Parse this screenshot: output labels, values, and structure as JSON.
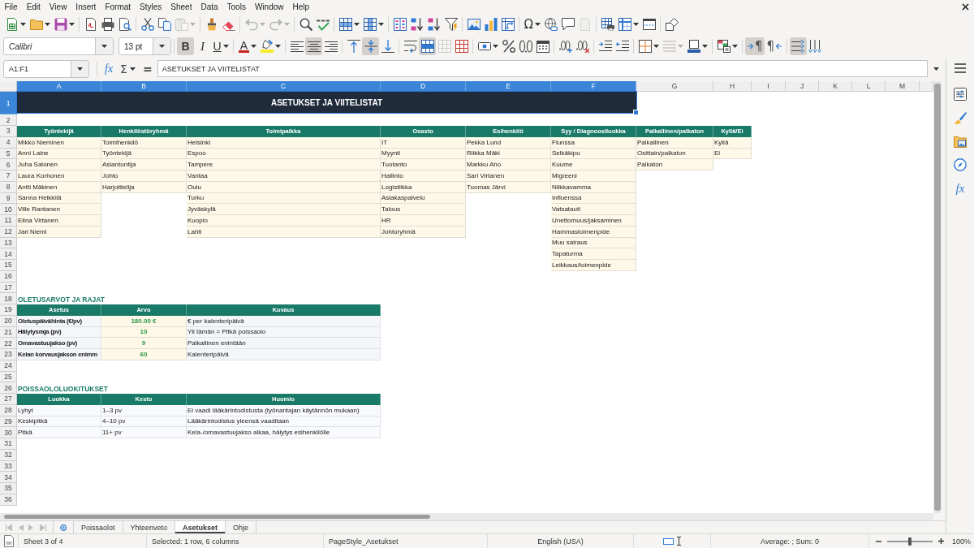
{
  "menu_bar": {
    "items": [
      "File",
      "Edit",
      "View",
      "Insert",
      "Format",
      "Styles",
      "Sheet",
      "Data",
      "Tools",
      "Window",
      "Help"
    ]
  },
  "standard_toolbar": {
    "groups": [
      [
        {
          "kind": "new",
          "menu": true,
          "disabled": false
        },
        {
          "kind": "open",
          "menu": true,
          "disabled": false
        },
        {
          "kind": "save",
          "menu": true,
          "disabled": false
        }
      ],
      [
        {
          "kind": "export_pdf",
          "menu": false,
          "disabled": false
        },
        {
          "kind": "print",
          "menu": false,
          "disabled": false
        },
        {
          "kind": "print_preview",
          "menu": false,
          "disabled": false
        }
      ],
      [
        {
          "kind": "cut",
          "menu": false,
          "disabled": false
        },
        {
          "kind": "copy",
          "menu": false,
          "disabled": false
        },
        {
          "kind": "paste",
          "menu": true,
          "disabled": true
        }
      ],
      [
        {
          "kind": "clone_format",
          "menu": false,
          "disabled": false
        },
        {
          "kind": "clear_format",
          "menu": false,
          "disabled": false
        }
      ],
      [
        {
          "kind": "undo",
          "menu": true,
          "disabled": true
        },
        {
          "kind": "redo",
          "menu": true,
          "disabled": true
        }
      ],
      [
        {
          "kind": "find_replace",
          "menu": false,
          "disabled": false
        },
        {
          "kind": "spelling",
          "menu": false,
          "disabled": false
        }
      ],
      [
        {
          "kind": "row",
          "menu": true,
          "disabled": false
        },
        {
          "kind": "column",
          "menu": true,
          "disabled": false
        }
      ],
      [
        {
          "kind": "sort",
          "menu": false,
          "disabled": false
        },
        {
          "kind": "sort_ascending",
          "menu": false,
          "disabled": false
        },
        {
          "kind": "sort_descending",
          "menu": false,
          "disabled": false
        },
        {
          "kind": "autofilter",
          "menu": false,
          "disabled": false
        }
      ],
      [
        {
          "kind": "image",
          "menu": false,
          "disabled": false
        },
        {
          "kind": "chart",
          "menu": false,
          "disabled": false
        },
        {
          "kind": "pivot_table",
          "menu": false,
          "disabled": false
        }
      ],
      [
        {
          "kind": "special_character",
          "glyph": "Ω",
          "menu": true,
          "disabled": false
        },
        {
          "kind": "hyperlink",
          "menu": false,
          "disabled": false
        },
        {
          "kind": "comment",
          "menu": false,
          "disabled": false
        },
        {
          "kind": "header_footer",
          "menu": false,
          "disabled": true
        }
      ],
      [
        {
          "kind": "print_area",
          "menu": false,
          "disabled": false
        },
        {
          "kind": "freeze",
          "menu": true,
          "disabled": false
        },
        {
          "kind": "split_window",
          "menu": false,
          "disabled": false
        }
      ],
      [
        {
          "kind": "draw_functions",
          "menu": false,
          "disabled": false
        }
      ]
    ]
  },
  "format_toolbar": {
    "font_name": "Calibri",
    "font_size": "13 pt",
    "groups": [
      [
        {
          "kind": "bold",
          "glyph": "B",
          "menu": false,
          "on": true,
          "disabled": false
        },
        {
          "kind": "italic",
          "glyph": "I",
          "menu": false,
          "on": false,
          "disabled": false
        },
        {
          "kind": "underline",
          "glyph": "U",
          "menu": true,
          "on": false,
          "disabled": false
        }
      ],
      [
        {
          "kind": "font_color",
          "glyph": "A",
          "menu": true,
          "on": false,
          "disabled": false
        },
        {
          "kind": "highlight",
          "menu": true,
          "on": false,
          "disabled": false
        }
      ],
      [
        {
          "kind": "align_left",
          "menu": false,
          "on": false,
          "disabled": false
        },
        {
          "kind": "align_center",
          "menu": false,
          "on": true,
          "disabled": false
        },
        {
          "kind": "align_right",
          "menu": false,
          "on": false,
          "disabled": false
        }
      ],
      [
        {
          "kind": "align_top",
          "menu": false,
          "on": false,
          "disabled": false
        },
        {
          "kind": "align_middle",
          "menu": false,
          "on": true,
          "disabled": false
        },
        {
          "kind": "align_bottom",
          "menu": false,
          "on": false,
          "disabled": false
        }
      ],
      [
        {
          "kind": "wrap_text",
          "menu": false,
          "on": false,
          "disabled": false
        },
        {
          "kind": "merge_center",
          "menu": false,
          "on": true,
          "disabled": false
        },
        {
          "kind": "merge_cells",
          "menu": false,
          "on": false,
          "disabled": true
        },
        {
          "kind": "unmerge",
          "menu": false,
          "on": false,
          "disabled": false
        }
      ],
      [
        {
          "kind": "currency",
          "menu": true,
          "on": false,
          "disabled": false
        },
        {
          "kind": "percent",
          "menu": false,
          "on": false,
          "disabled": false
        },
        {
          "kind": "number",
          "menu": false,
          "on": false,
          "disabled": false
        },
        {
          "kind": "date",
          "menu": false,
          "on": false,
          "disabled": false
        }
      ],
      [
        {
          "kind": "add_decimal",
          "menu": false,
          "on": false,
          "disabled": false
        },
        {
          "kind": "delete_decimal",
          "menu": false,
          "on": false,
          "disabled": false
        }
      ],
      [
        {
          "kind": "increase_indent",
          "menu": false,
          "on": false,
          "disabled": false
        },
        {
          "kind": "decrease_indent",
          "menu": false,
          "on": false,
          "disabled": false
        }
      ],
      [
        {
          "kind": "borders",
          "menu": true,
          "on": false,
          "disabled": false
        },
        {
          "kind": "border_style",
          "menu": true,
          "on": false,
          "disabled": true
        },
        {
          "kind": "border_color",
          "menu": true,
          "on": false,
          "disabled": false
        }
      ],
      [
        {
          "kind": "conditional",
          "menu": true,
          "on": false,
          "disabled": false
        }
      ],
      [
        {
          "kind": "ltr",
          "glyph": "¶",
          "menu": false,
          "on": true,
          "disabled": false
        },
        {
          "kind": "rtl",
          "glyph": "¶",
          "menu": false,
          "on": false,
          "disabled": false
        }
      ],
      [
        {
          "kind": "text_ltr",
          "menu": false,
          "on": true,
          "disabled": false
        },
        {
          "kind": "text_ttb",
          "menu": false,
          "on": false,
          "disabled": false
        }
      ]
    ]
  },
  "formula_bar": {
    "name_box": "A1:F1",
    "function_wizard": "fx",
    "sum": "Σ",
    "formula": "=",
    "content": "ASETUKSET JA VIITELISTAT"
  },
  "sheet": {
    "columns": [
      {
        "label": "A",
        "selected": true
      },
      {
        "label": "B",
        "selected": true
      },
      {
        "label": "C",
        "selected": true
      },
      {
        "label": "D",
        "selected": true
      },
      {
        "label": "E",
        "selected": true
      },
      {
        "label": "F",
        "selected": true
      },
      {
        "label": "G",
        "selected": false
      },
      {
        "label": "H",
        "selected": false
      },
      {
        "label": "I",
        "selected": false
      },
      {
        "label": "J",
        "selected": false
      },
      {
        "label": "K",
        "selected": false
      },
      {
        "label": "L",
        "selected": false
      },
      {
        "label": "M",
        "selected": false
      }
    ],
    "rows": [
      {
        "label": "1",
        "selected": true
      },
      {
        "label": "2",
        "selected": false
      },
      {
        "label": "3",
        "selected": false
      },
      {
        "label": "4",
        "selected": false
      },
      {
        "label": "5",
        "selected": false
      },
      {
        "label": "6",
        "selected": false
      },
      {
        "label": "7",
        "selected": false
      },
      {
        "label": "8",
        "selected": false
      },
      {
        "label": "9",
        "selected": false
      },
      {
        "label": "10",
        "selected": false
      },
      {
        "label": "11",
        "selected": false
      },
      {
        "label": "12",
        "selected": false
      },
      {
        "label": "13",
        "selected": false
      },
      {
        "label": "14",
        "selected": false
      },
      {
        "label": "15",
        "selected": false
      },
      {
        "label": "16",
        "selected": false
      },
      {
        "label": "17",
        "selected": false
      },
      {
        "label": "18",
        "selected": false
      },
      {
        "label": "19",
        "selected": false
      },
      {
        "label": "20",
        "selected": false
      },
      {
        "label": "21",
        "selected": false
      },
      {
        "label": "22",
        "selected": false
      },
      {
        "label": "23",
        "selected": false
      },
      {
        "label": "24",
        "selected": false
      },
      {
        "label": "25",
        "selected": false
      },
      {
        "label": "26",
        "selected": false
      },
      {
        "label": "27",
        "selected": false
      },
      {
        "label": "28",
        "selected": false
      },
      {
        "label": "29",
        "selected": false
      },
      {
        "label": "30",
        "selected": false
      },
      {
        "label": "31",
        "selected": false
      },
      {
        "label": "32",
        "selected": false
      },
      {
        "label": "33",
        "selected": false
      },
      {
        "label": "34",
        "selected": false
      },
      {
        "label": "35",
        "selected": false
      },
      {
        "label": "36",
        "selected": false
      }
    ],
    "title": {
      "text": "ASETUKSET JA VIITELISTAT",
      "selected": true
    },
    "reference_lists": [
      {
        "header": "Työntekijä",
        "items": [
          "Mikko Nieminen",
          "Anni Laine",
          "Juha Salonen",
          "Laura Korhonen",
          "Antti Mäkinen",
          "Sanna Heikkilä",
          "Ville Rantanen",
          "Elina Virtanen",
          "Jari Niemi"
        ]
      },
      {
        "header": "Henkilöstöryhmä",
        "items": [
          "Toimihenkilö",
          "Työntekijä",
          "Asiantuntija",
          "Johto",
          "Harjoittelija"
        ]
      },
      {
        "header": "Toimipaikka",
        "items": [
          "Helsinki",
          "Espoo",
          "Tampere",
          "Vantaa",
          "Oulu",
          "Turku",
          "Jyväskylä",
          "Kuopio",
          "Lahti"
        ]
      },
      {
        "header": "Osasto",
        "items": [
          "IT",
          "Myynti",
          "Tuotanto",
          "Hallinto",
          "Logistiikka",
          "Asiakaspalvelu",
          "Talous",
          "HR",
          "Johtoryhmä"
        ]
      },
      {
        "header": "Esihenkilö",
        "items": [
          "Pekka Lund",
          "Riikka Mäki",
          "Markku Aho",
          "Sari Virtanen",
          "Tuomas Järvi"
        ]
      },
      {
        "header": "Syy / Diagnoosiluokka",
        "items": [
          "Flunssa",
          "Selkäkipu",
          "Kuume",
          "Migreeni",
          "Nilkkavamma",
          "Influenssa",
          "Vatsatauti",
          "Unettomuus/jaksaminen",
          "Hammastoimenpide",
          "Muu sairaus",
          "Tapaturma",
          "Leikkaus/toimenpide"
        ]
      },
      {
        "header": "Palkallinen/palkaton",
        "items": [
          "Palkallinen",
          "Osittain/palkaton",
          "Palkaton"
        ]
      },
      {
        "header": "Kyllä/Ei",
        "items": [
          "Kyllä",
          "Ei"
        ]
      }
    ],
    "sections": [
      {
        "kind": "settings",
        "heading": "OLETUSARVOT JA RAJAT",
        "columns": [
          "Asetus",
          "Arvo",
          "Kuvaus"
        ],
        "rows": [
          [
            "Oletuspäivähinta (€/pv)",
            "180.00 €",
            "€ per kalenteripäivä"
          ],
          [
            "Hälytysraja (pv)",
            "10",
            "Yli tämän = Pitkä poissaolo"
          ],
          [
            "Omavastuujakso (pv)",
            "9",
            "Palkallinen enintään"
          ],
          [
            "Kelan korvausjakson enimm",
            "60",
            "Kalenteripäivä"
          ]
        ]
      },
      {
        "kind": "classes",
        "heading": "POISSAOLOLUOKITUKSET",
        "columns": [
          "Luokka",
          "Kesto",
          "Huomio"
        ],
        "rows": [
          [
            "Lyhyt",
            "1–3 pv",
            "Ei vaadi lääkärintodistusta (työnantajan käytännön mukaan)"
          ],
          [
            "Keskipitkä",
            "4–10 pv",
            "Lääkärintodistus yleensä vaaditaan"
          ],
          [
            "Pitkä",
            "11+ pv",
            "Kela-/omavastuujakso alkaa, hälytys esihenkilölle"
          ]
        ]
      }
    ]
  },
  "sidebar": {
    "tabs": [
      {
        "kind": "properties",
        "selected": false
      },
      {
        "kind": "styles",
        "selected": false
      },
      {
        "kind": "gallery",
        "selected": false
      },
      {
        "kind": "navigator",
        "selected": false
      },
      {
        "kind": "functions",
        "glyph": "fx",
        "selected": false
      }
    ]
  },
  "sheet_tabs": {
    "navigation_disabled": true,
    "tabs": [
      {
        "label": "Poissaolot",
        "selected": false
      },
      {
        "label": "Yhteenveto",
        "selected": false
      },
      {
        "label": "Asetukset",
        "selected": true
      },
      {
        "label": "Ohje",
        "selected": false
      }
    ]
  },
  "status_bar": {
    "sheet": "Sheet 3 of 4",
    "selection": "Selected: 1 row, 6 columns",
    "page_style": "PageStyle_Asetukset",
    "language": "English (USA)",
    "summary": "Average: ; Sum: 0",
    "zoom": {
      "level": 0.5,
      "reading": "100%"
    }
  }
}
